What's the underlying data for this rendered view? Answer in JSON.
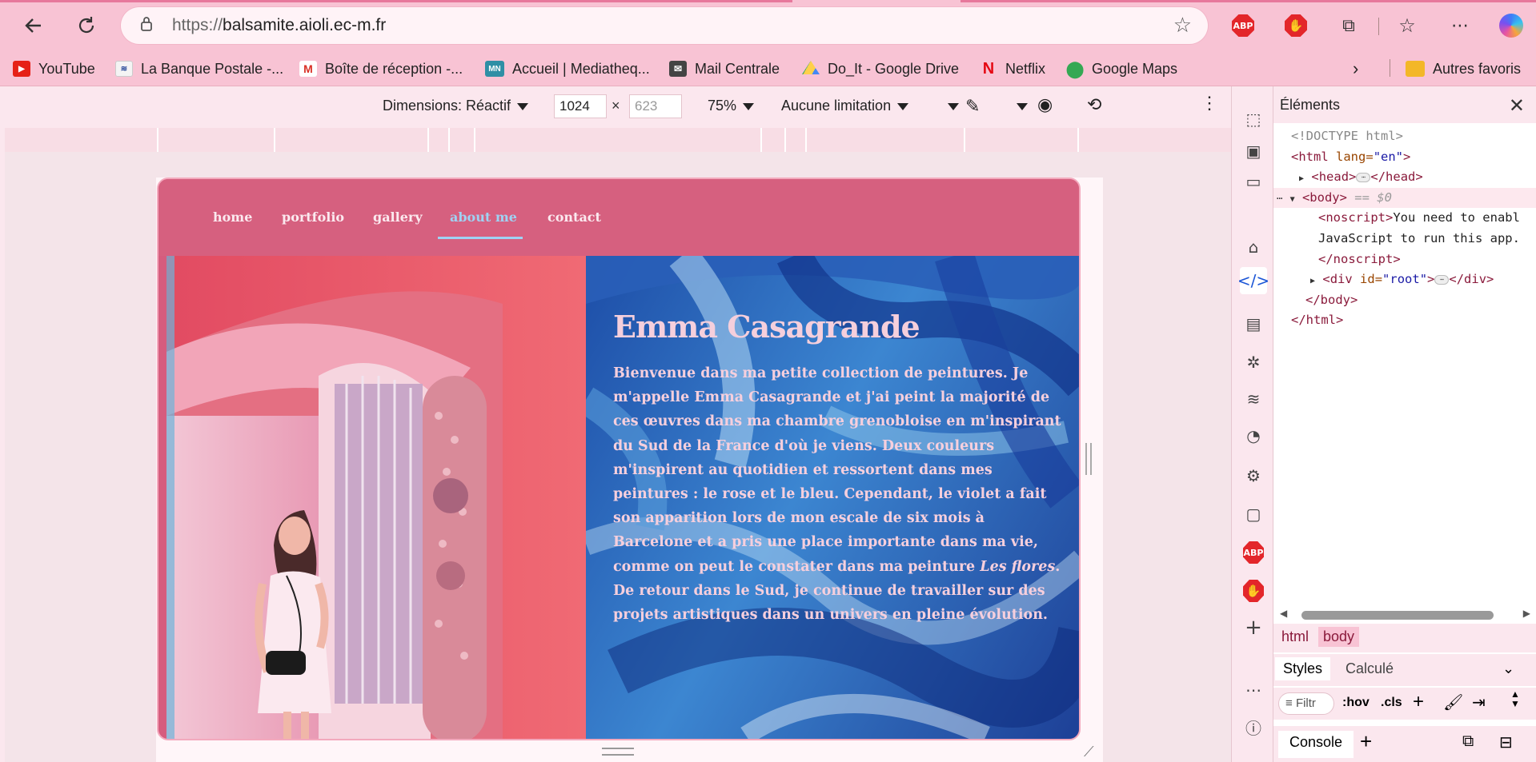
{
  "browser": {
    "url_prefix": "https://",
    "url_domain": "balsamite.aioli.ec-m.fr",
    "extensions": [
      "ABP",
      "ad-block-hand",
      "puzzle",
      "favorites",
      "more",
      "copilot"
    ]
  },
  "bookmarks": {
    "items": [
      {
        "label": "YouTube",
        "icon": "youtube-icon"
      },
      {
        "label": "La Banque Postale -...",
        "icon": "banque-postale-icon"
      },
      {
        "label": "Boîte de réception -...",
        "icon": "gmail-icon"
      },
      {
        "label": "Accueil | Mediatheq...",
        "icon": "mn-icon"
      },
      {
        "label": "Mail Centrale",
        "icon": "mail-icon"
      },
      {
        "label": "Do_It - Google Drive",
        "icon": "google-drive-icon"
      },
      {
        "label": "Netflix",
        "icon": "netflix-icon"
      },
      {
        "label": "Google Maps",
        "icon": "google-maps-icon"
      }
    ],
    "other": "Autres favoris"
  },
  "devtoolbar": {
    "dimensions": "Dimensions: Réactif",
    "width": "1024",
    "x": "×",
    "height_placeholder": "623",
    "zoom": "75%",
    "throttling": "Aucune limitation"
  },
  "site": {
    "nav": [
      "home",
      "portfolio",
      "gallery",
      "about me",
      "contact"
    ],
    "active_nav": "about me",
    "name": "Emma Casagrande",
    "bio_part1": "Bienvenue dans ma petite collection de peintures. Je m'appelle Emma Casagrande et j'ai peint la majorité de ces œuvres dans ma chambre grenobloise en m'inspirant du Sud de la France d'où je viens. Deux couleurs m'inspirent au quotidien et ressortent dans mes peintures : le rose et le bleu. Cependant, le violet a fait son apparition lors de mon escale de six mois à Barcelone et a pris une place importante dans ma vie, comme on peut le constater dans ma peinture ",
    "bio_italic": "Les flores",
    "bio_part2": ". De retour dans le Sud, je continue de travailler sur des projets artistiques dans un univers en pleine évolution."
  },
  "devtools": {
    "title": "Éléments",
    "code": {
      "doctype": "<!DOCTYPE html>",
      "html_open_tag": "<html",
      "html_lang_attr": "lang=",
      "html_lang_val": "\"en\"",
      "head_open": "<head>",
      "head_close": "</head>",
      "body_open": "<body>",
      "body_eq": "== $0",
      "noscript_open": "<noscript>",
      "noscript_text1": "You need to enabl",
      "noscript_text2": "JavaScript to run this app.",
      "noscript_close": "</noscript>",
      "div_open_tag": "<div",
      "div_id_attr": "id=",
      "div_id_val": "\"root\"",
      "div_close": "</div>",
      "body_close": "</body>",
      "html_close": "</html>",
      "gt": ">"
    },
    "breadcrumbs": [
      "html",
      "body"
    ],
    "style_tabs": [
      "Styles",
      "Calculé"
    ],
    "filter_placeholder": "Filtr",
    "hov": ":hov",
    "cls": ".cls",
    "console": "Console"
  },
  "colors": {
    "chrome_pink": "#f8c3d4",
    "site_nav_pink": "#d6607f",
    "active_nav_blue": "#9fd2f3",
    "hero_text_pink": "#f5cfdc"
  }
}
